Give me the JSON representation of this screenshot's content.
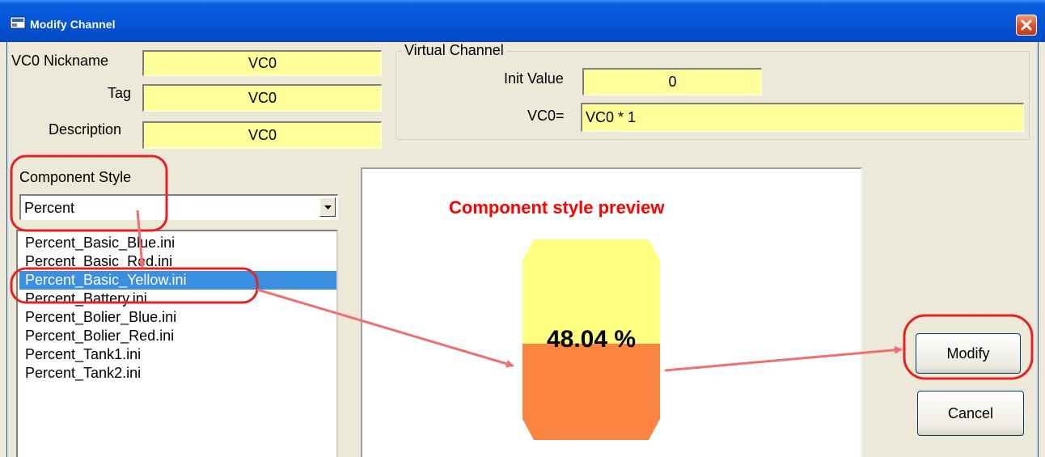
{
  "window": {
    "title": "Modify Channel"
  },
  "form": {
    "nickname_label": "VC0 Nickname",
    "nickname_value": "VC0",
    "tag_label": "Tag",
    "tag_value": "VC0",
    "description_label": "Description",
    "description_value": "VC0"
  },
  "virtual_channel": {
    "group_title": "Virtual Channel",
    "init_label": "Init Value",
    "init_value": "0",
    "expr_label": "VC0=",
    "expr_value": "VC0 * 1"
  },
  "component_style": {
    "label": "Component Style",
    "selected": "Percent",
    "files": [
      "Percent_Basic_Blue.ini",
      "Percent_Basic_Red.ini",
      "Percent_Basic_Yellow.ini",
      "Percent_Battery.ini",
      "Percent_Bolier_Blue.ini",
      "Percent_Bolier_Red.ini",
      "Percent_Tank1.ini",
      "Percent_Tank2.ini"
    ],
    "selected_file": "Percent_Basic_Yellow.ini"
  },
  "preview": {
    "title": "Component style preview",
    "value_text": "48.04 %",
    "fill_fraction": 0.4804,
    "empty_color": "#ffff80",
    "fill_color": "#fa8440"
  },
  "buttons": {
    "modify": "Modify",
    "cancel": "Cancel"
  },
  "colors": {
    "titlebar": "#0553d4",
    "field_bg": "#ffff99",
    "selection": "#3b8fe0",
    "annotation": "#e82020",
    "arrow": "#f07070"
  },
  "icons": [
    "app-icon",
    "close-icon",
    "dropdown-arrow-icon"
  ]
}
